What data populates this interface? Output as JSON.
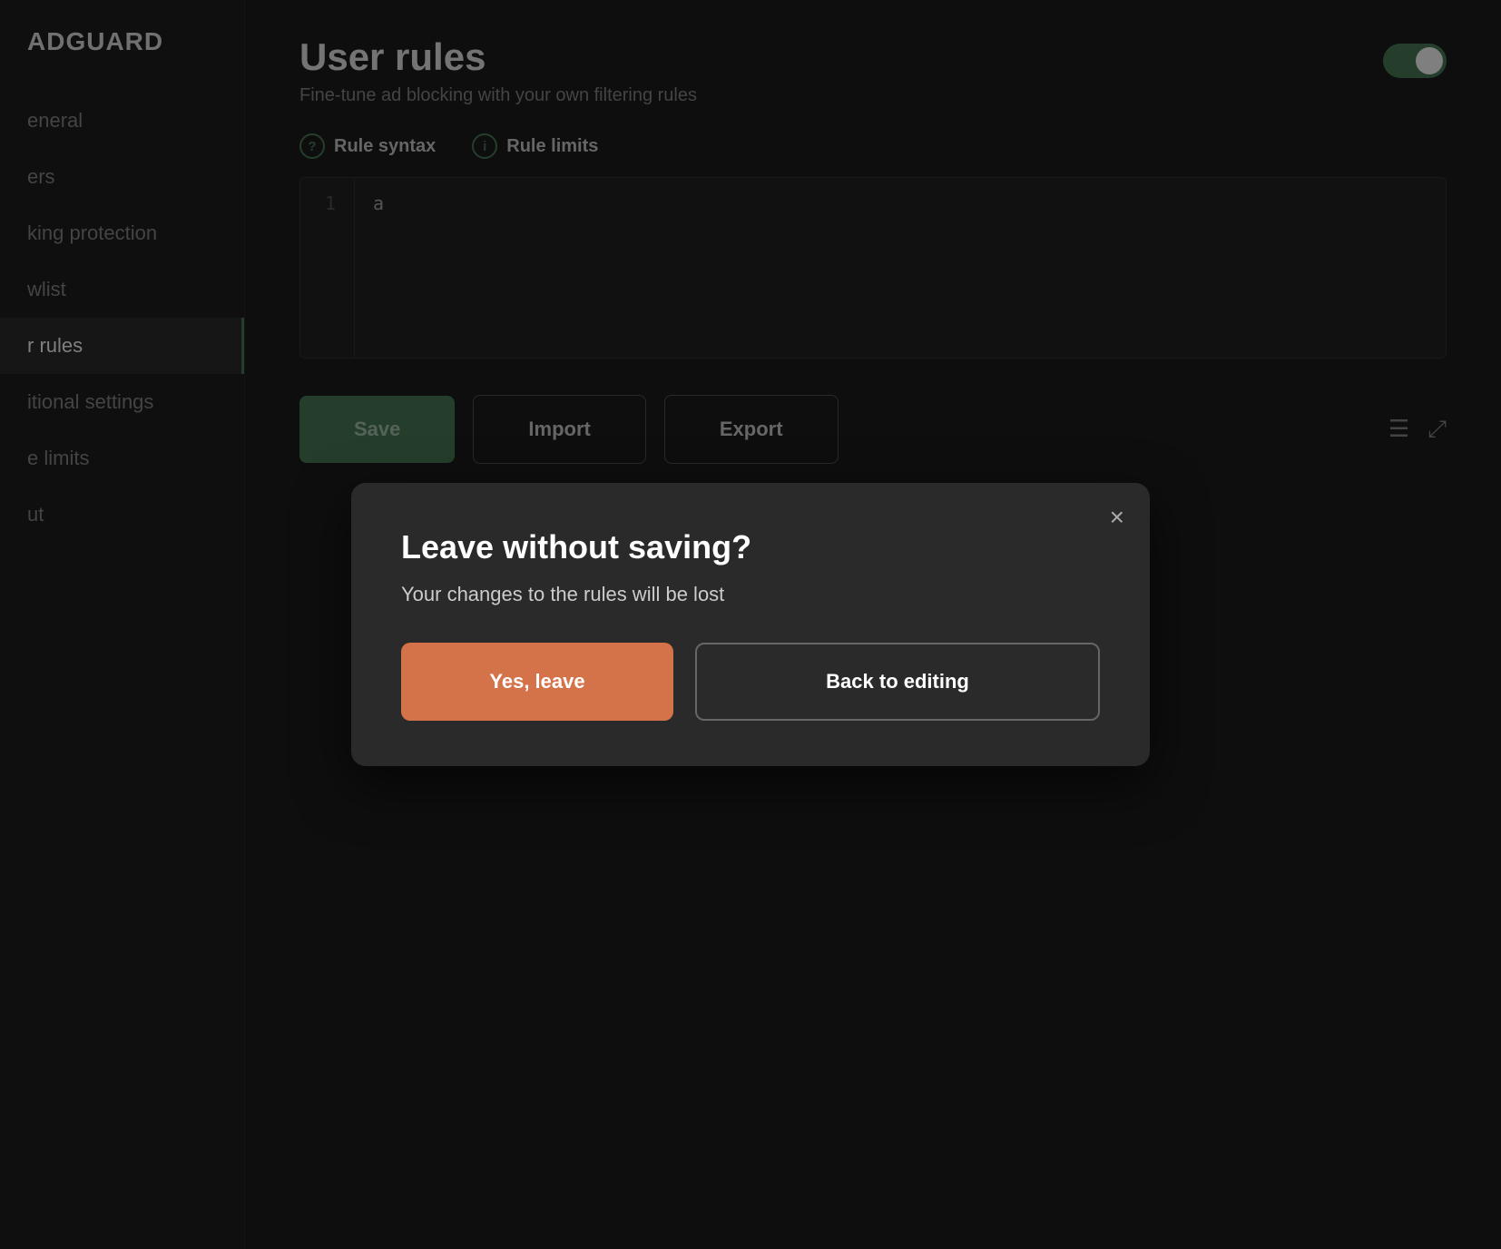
{
  "app": {
    "name": "ADGUARD"
  },
  "sidebar": {
    "items": [
      {
        "id": "general",
        "label": "eneral",
        "active": false
      },
      {
        "id": "filters",
        "label": "ers",
        "active": false
      },
      {
        "id": "blocking-protection",
        "label": "king protection",
        "active": false
      },
      {
        "id": "allowlist",
        "label": "wlist",
        "active": false
      },
      {
        "id": "user-rules",
        "label": "r rules",
        "active": true
      },
      {
        "id": "additional-settings",
        "label": "itional settings",
        "active": false
      },
      {
        "id": "rate-limits",
        "label": "e limits",
        "active": false
      },
      {
        "id": "about",
        "label": "ut",
        "active": false
      }
    ]
  },
  "page": {
    "title": "User rules",
    "subtitle": "Fine-tune ad blocking with your own filtering rules",
    "toggle_enabled": true
  },
  "info_links": [
    {
      "id": "rule-syntax",
      "icon": "?",
      "label": "Rule syntax"
    },
    {
      "id": "rule-limits",
      "icon": "i",
      "label": "Rule limits"
    }
  ],
  "editor": {
    "line_number": "1",
    "code_content": "a"
  },
  "toolbar": {
    "save_label": "Save",
    "import_label": "Import",
    "export_label": "Export"
  },
  "dialog": {
    "title": "Leave without saving?",
    "body": "Your changes to the rules will be lost",
    "confirm_label": "Yes, leave",
    "cancel_label": "Back to editing",
    "close_icon": "×"
  }
}
